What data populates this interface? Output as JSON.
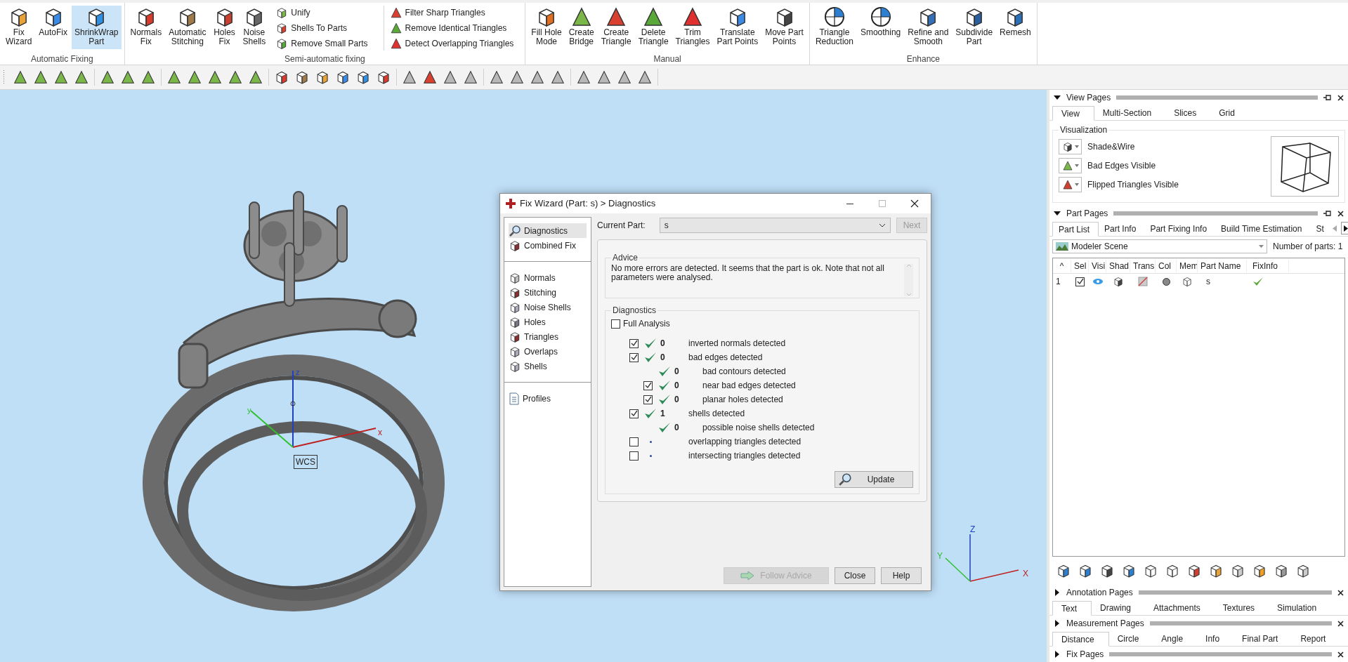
{
  "ribbon": {
    "groups": [
      {
        "label": "Automatic Fixing",
        "buttons": [
          {
            "label": "Fix\nWizard",
            "selected": false
          },
          {
            "label": "AutoFix",
            "selected": false
          },
          {
            "label": "ShrinkWrap\nPart",
            "selected": true
          }
        ]
      },
      {
        "label": "Semi-automatic fixing",
        "buttons": [
          {
            "label": "Normals\nFix",
            "selected": false
          },
          {
            "label": "Automatic\nStitching",
            "selected": false
          },
          {
            "label": "Holes\nFix",
            "selected": false
          },
          {
            "label": "Noise\nShells",
            "selected": false
          }
        ],
        "small_columns": [
          [
            "Unify",
            "Shells To Parts",
            "Remove Small Parts"
          ],
          [
            "Filter Sharp Triangles",
            "Remove Identical Triangles",
            "Detect Overlapping Triangles"
          ]
        ]
      },
      {
        "label": "Manual",
        "buttons": [
          {
            "label": "Fill Hole\nMode",
            "selected": false
          },
          {
            "label": "Create\nBridge",
            "selected": false
          },
          {
            "label": "Create\nTriangle",
            "selected": false
          },
          {
            "label": "Delete\nTriangle",
            "selected": false
          },
          {
            "label": "Trim\nTriangles",
            "selected": false
          },
          {
            "label": "Translate\nPart Points",
            "selected": false
          },
          {
            "label": "Move Part\nPoints",
            "selected": false
          }
        ]
      },
      {
        "label": "Enhance",
        "buttons": [
          {
            "label": "Triangle\nReduction",
            "selected": false
          },
          {
            "label": "Smoothing",
            "selected": false
          },
          {
            "label": "Refine and\nSmooth",
            "selected": false
          },
          {
            "label": "Subdivide\nPart",
            "selected": false
          },
          {
            "label": "Remesh",
            "selected": false
          }
        ]
      }
    ]
  },
  "viewport": {
    "wcs_label": "WCS",
    "wcs_axes": [
      "z",
      "x",
      "y"
    ],
    "corner_axes": [
      "Z",
      "X",
      "Y"
    ]
  },
  "dialog": {
    "title": "Fix Wizard (Part: s) > Diagnostics",
    "nav": [
      [
        {
          "label": "Diagnostics",
          "selected": true
        },
        {
          "label": "Combined Fix",
          "selected": false
        }
      ],
      [
        {
          "label": "Normals",
          "selected": false
        },
        {
          "label": "Stitching",
          "selected": false
        },
        {
          "label": "Noise Shells",
          "selected": false
        },
        {
          "label": "Holes",
          "selected": false
        },
        {
          "label": "Triangles",
          "selected": false
        },
        {
          "label": "Overlaps",
          "selected": false
        },
        {
          "label": "Shells",
          "selected": false
        }
      ],
      [
        {
          "label": "Profiles",
          "selected": false
        }
      ]
    ],
    "current_part": {
      "label": "Current Part:",
      "value": "s"
    },
    "next_button": {
      "label": "Next",
      "disabled": true
    },
    "advice": {
      "title": "Advice",
      "text": "No more errors are detected. It seems that the part is ok. Note that not all parameters were analysed."
    },
    "diagnostics": {
      "title": "Diagnostics",
      "full_analysis": {
        "label": "Full Analysis",
        "checked": false
      },
      "rows": [
        {
          "kind": "checkable",
          "checked": true,
          "passed": true,
          "count": "0",
          "label": "inverted normals detected"
        },
        {
          "kind": "checkable",
          "checked": true,
          "passed": true,
          "count": "0",
          "label": "bad edges detected",
          "children": [
            {
              "kind": "plain",
              "passed": true,
              "count": "0",
              "label": "bad contours detected"
            },
            {
              "kind": "checkable",
              "checked": true,
              "passed": true,
              "count": "0",
              "label": "near bad edges detected"
            },
            {
              "kind": "checkable",
              "checked": true,
              "passed": true,
              "count": "0",
              "label": "planar holes detected"
            }
          ]
        },
        {
          "kind": "checkable",
          "checked": true,
          "passed": true,
          "count": "1",
          "label": "shells detected",
          "children": [
            {
              "kind": "plain",
              "passed": true,
              "count": "0",
              "label": "possible noise shells detected"
            }
          ]
        },
        {
          "kind": "checkable",
          "checked": false,
          "passed": false,
          "label": "overlapping triangles detected"
        },
        {
          "kind": "checkable",
          "checked": false,
          "passed": false,
          "label": "intersecting triangles detected"
        }
      ],
      "update_button": "Update"
    },
    "buttons": [
      {
        "label": "Follow Advice",
        "disabled": true
      },
      {
        "label": "Close",
        "disabled": false
      },
      {
        "label": "Help",
        "disabled": false
      }
    ]
  },
  "right_panel": {
    "view_pages": {
      "title": "View Pages",
      "expanded": true,
      "tabs": [
        {
          "label": "View",
          "selected": true
        },
        {
          "label": "Multi-Section",
          "selected": false
        },
        {
          "label": "Slices",
          "selected": false
        },
        {
          "label": "Grid",
          "selected": false
        }
      ],
      "visualization": {
        "title": "Visualization",
        "options": [
          "Shade&Wire",
          "Bad Edges Visible",
          "Flipped Triangles Visible"
        ]
      }
    },
    "part_pages": {
      "title": "Part Pages",
      "expanded": true,
      "tabs": [
        {
          "label": "Part List",
          "selected": true
        },
        {
          "label": "Part Info",
          "selected": false
        },
        {
          "label": "Part Fixing Info",
          "selected": false
        },
        {
          "label": "Build Time Estimation",
          "selected": false
        },
        {
          "label": "St",
          "selected": false
        }
      ],
      "scene": "Modeler Scene",
      "parts_count": "Number of parts: 1",
      "columns": [
        "^",
        "Sel",
        "Visi",
        "Shad",
        "Trans",
        "Col",
        "Mem",
        "Part Name",
        "FixInfo"
      ],
      "rows": [
        {
          "index": "1",
          "checked": true,
          "visible": true,
          "part_name": "s",
          "fixed": true
        }
      ]
    },
    "annotation_pages": {
      "title": "Annotation Pages",
      "expanded": false,
      "tabs": [
        {
          "label": "Text",
          "selected": true
        },
        {
          "label": "Drawing",
          "selected": false
        },
        {
          "label": "Attachments",
          "selected": false
        },
        {
          "label": "Textures",
          "selected": false
        },
        {
          "label": "Simulation",
          "selected": false
        }
      ]
    },
    "measurement_pages": {
      "title": "Measurement Pages",
      "expanded": false,
      "tabs": [
        {
          "label": "Distance",
          "selected": true
        },
        {
          "label": "Circle",
          "selected": false
        },
        {
          "label": "Angle",
          "selected": false
        },
        {
          "label": "Info",
          "selected": false
        },
        {
          "label": "Final Part",
          "selected": false
        },
        {
          "label": "Report",
          "selected": false
        }
      ]
    },
    "fix_pages": {
      "title": "Fix Pages",
      "expanded": false
    }
  }
}
